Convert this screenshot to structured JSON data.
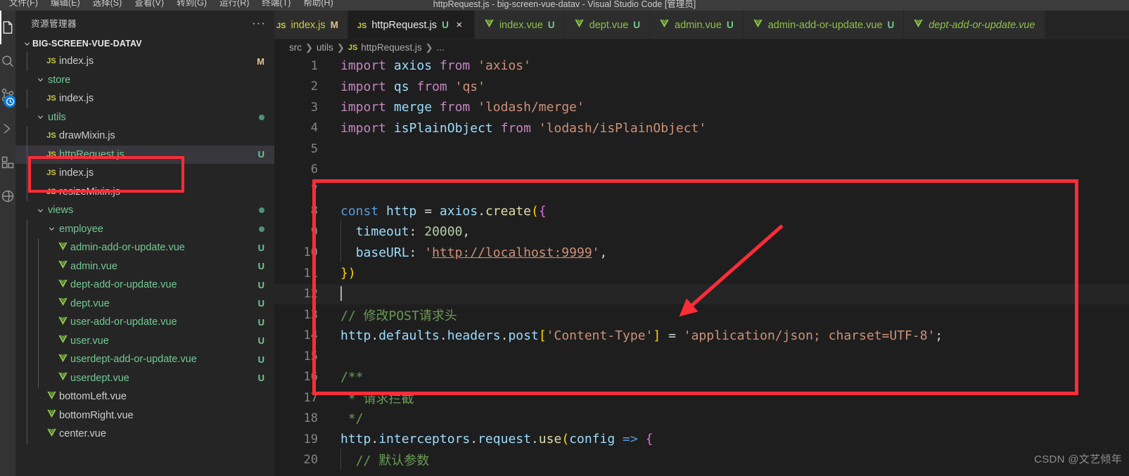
{
  "window": {
    "title": "httpRequest.js - big-screen-vue-datav - Visual Studio Code [管理员]",
    "accent": "#0e7ad4",
    "annotation_color": "#fc2c38",
    "background": "#1e1e1e"
  },
  "menubar": {
    "items": [
      {
        "label": "文件(F)",
        "name": "menu-file"
      },
      {
        "label": "编辑(E)",
        "name": "menu-edit"
      },
      {
        "label": "选择(S)",
        "name": "menu-selection"
      },
      {
        "label": "查看(V)",
        "name": "menu-view"
      },
      {
        "label": "转到(G)",
        "name": "menu-go"
      },
      {
        "label": "运行(R)",
        "name": "menu-run"
      },
      {
        "label": "终端(T)",
        "name": "menu-terminal"
      },
      {
        "label": "帮助(H)",
        "name": "menu-help"
      }
    ]
  },
  "activitybar": {
    "items": [
      {
        "icon": "files-explorer-icon",
        "active": true
      },
      {
        "icon": "search-icon",
        "active": false
      },
      {
        "icon": "source-control-icon",
        "active": false,
        "badge": "clock-badge-icon"
      },
      {
        "icon": "run-debug-icon",
        "active": false
      },
      {
        "icon": "extensions-icon",
        "active": false
      },
      {
        "icon": "remote-explorer-icon",
        "active": false
      }
    ]
  },
  "sidebar": {
    "header_title": "资源管理器",
    "more_actions": "···",
    "root_folder": "BIG-SCREEN-VUE-DATAV",
    "tree": [
      {
        "label": "index.js",
        "icon": "js-file-icon",
        "indent": 2,
        "deco": "M",
        "deco_color": "#e2c08d",
        "guides": 1
      },
      {
        "label": "store",
        "icon": "folder-open-icon",
        "indent": 1,
        "deco": "",
        "guides": 0
      },
      {
        "label": "index.js",
        "icon": "js-file-icon",
        "indent": 2,
        "deco": "",
        "deco_color": "",
        "guides": 1
      },
      {
        "label": "utils",
        "icon": "folder-open-icon",
        "indent": 1,
        "deco": "dot",
        "deco_color": "#4d9375",
        "guides": 0
      },
      {
        "label": "drawMixin.js",
        "icon": "js-file-icon",
        "indent": 2,
        "deco": "",
        "deco_color": "",
        "guides": 1
      },
      {
        "label": "httpRequest.js",
        "icon": "js-file-icon",
        "indent": 2,
        "deco": "U",
        "deco_color": "#73c991",
        "guides": 1,
        "state": "selected",
        "name_color": "#73c991"
      },
      {
        "label": "index.js",
        "icon": "js-file-icon",
        "indent": 2,
        "deco": "",
        "deco_color": "",
        "guides": 1
      },
      {
        "label": "resizeMixin.js",
        "icon": "js-file-icon",
        "indent": 2,
        "deco": "",
        "deco_color": "",
        "guides": 1
      },
      {
        "label": "views",
        "icon": "folder-open-icon",
        "indent": 1,
        "deco": "dot",
        "deco_color": "#4d9375",
        "guides": 0
      },
      {
        "label": "employee",
        "icon": "folder-open-icon",
        "indent": 2,
        "deco": "dot",
        "deco_color": "#4d9375",
        "guides": 1
      },
      {
        "label": "admin-add-or-update.vue",
        "icon": "vue-file-icon",
        "indent": 3,
        "deco": "U",
        "deco_color": "#73c991",
        "guides": 2,
        "name_color": "#73c991"
      },
      {
        "label": "admin.vue",
        "icon": "vue-file-icon",
        "indent": 3,
        "deco": "U",
        "deco_color": "#73c991",
        "guides": 2,
        "name_color": "#73c991"
      },
      {
        "label": "dept-add-or-update.vue",
        "icon": "vue-file-icon",
        "indent": 3,
        "deco": "U",
        "deco_color": "#73c991",
        "guides": 2,
        "name_color": "#73c991"
      },
      {
        "label": "dept.vue",
        "icon": "vue-file-icon",
        "indent": 3,
        "deco": "U",
        "deco_color": "#73c991",
        "guides": 2,
        "name_color": "#73c991"
      },
      {
        "label": "user-add-or-update.vue",
        "icon": "vue-file-icon",
        "indent": 3,
        "deco": "U",
        "deco_color": "#73c991",
        "guides": 2,
        "name_color": "#73c991"
      },
      {
        "label": "user.vue",
        "icon": "vue-file-icon",
        "indent": 3,
        "deco": "U",
        "deco_color": "#73c991",
        "guides": 2,
        "name_color": "#73c991"
      },
      {
        "label": "userdept-add-or-update.vue",
        "icon": "vue-file-icon",
        "indent": 3,
        "deco": "U",
        "deco_color": "#73c991",
        "guides": 2,
        "name_color": "#73c991"
      },
      {
        "label": "userdept.vue",
        "icon": "vue-file-icon",
        "indent": 3,
        "deco": "U",
        "deco_color": "#73c991",
        "guides": 2,
        "name_color": "#73c991"
      },
      {
        "label": "bottomLeft.vue",
        "icon": "vue-file-icon",
        "indent": 2,
        "deco": "",
        "deco_color": "",
        "guides": 1
      },
      {
        "label": "bottomRight.vue",
        "icon": "vue-file-icon",
        "indent": 2,
        "deco": "",
        "deco_color": "",
        "guides": 1
      },
      {
        "label": "center.vue",
        "icon": "vue-file-icon",
        "indent": 2,
        "deco": "",
        "deco_color": "",
        "guides": 1
      }
    ]
  },
  "tabs": [
    {
      "name": "index.js",
      "icon": "js-file-icon",
      "status": "M",
      "status_color": "#e2c08d",
      "active": false,
      "preview": false,
      "truncated": true
    },
    {
      "name": "httpRequest.js",
      "icon": "js-file-icon",
      "status": "U",
      "status_color": "#73c991",
      "active": true,
      "preview": false,
      "close": "×"
    },
    {
      "name": "index.vue",
      "icon": "vue-file-icon",
      "status": "U",
      "status_color": "#73c991",
      "active": false,
      "preview": false
    },
    {
      "name": "dept.vue",
      "icon": "vue-file-icon",
      "status": "U",
      "status_color": "#73c991",
      "active": false,
      "preview": false
    },
    {
      "name": "admin.vue",
      "icon": "vue-file-icon",
      "status": "U",
      "status_color": "#73c991",
      "active": false,
      "preview": false
    },
    {
      "name": "admin-add-or-update.vue",
      "icon": "vue-file-icon",
      "status": "U",
      "status_color": "#73c991",
      "active": false,
      "preview": false
    },
    {
      "name": "dept-add-or-update.vue",
      "icon": "vue-file-icon",
      "status": "",
      "status_color": "#73c991",
      "active": false,
      "preview": true
    }
  ],
  "breadcrumbs": {
    "items": [
      "src",
      "utils",
      "httpRequest.js",
      "..."
    ],
    "file_icon": "js-file-icon",
    "separator": "❯"
  },
  "code": {
    "first_line": 1,
    "current_line": 12,
    "lines": [
      {
        "n": 1,
        "text": "import axios from 'axios'"
      },
      {
        "n": 2,
        "text": "import qs from 'qs'"
      },
      {
        "n": 3,
        "text": "import merge from 'lodash/merge'"
      },
      {
        "n": 4,
        "text": "import isPlainObject from 'lodash/isPlainObject'"
      },
      {
        "n": 5,
        "text": ""
      },
      {
        "n": 6,
        "text": ""
      },
      {
        "n": 7,
        "text": ""
      },
      {
        "n": 8,
        "text": "const http = axios.create({"
      },
      {
        "n": 9,
        "text": "  timeout: 20000,"
      },
      {
        "n": 10,
        "text": "  baseURL: 'http://localhost:9999',"
      },
      {
        "n": 11,
        "text": "})"
      },
      {
        "n": 12,
        "text": ""
      },
      {
        "n": 13,
        "text": "// 修改POST请求头"
      },
      {
        "n": 14,
        "text": "http.defaults.headers.post['Content-Type'] = 'application/json; charset=UTF-8';"
      },
      {
        "n": 15,
        "text": ""
      },
      {
        "n": 16,
        "text": "/**"
      },
      {
        "n": 17,
        "text": " * 请求拦截"
      },
      {
        "n": 18,
        "text": " */"
      },
      {
        "n": 19,
        "text": "http.interceptors.request.use(config => {"
      },
      {
        "n": 20,
        "text": "  // 默认参数"
      }
    ]
  },
  "annotations": {
    "sidebar_box_label": "highlight-httprequest-and-index",
    "code_box_label": "highlight-axios-config-block",
    "arrow_label": "arrow-pointing-to-content-type"
  },
  "watermark": "CSDN @文艺倾年"
}
